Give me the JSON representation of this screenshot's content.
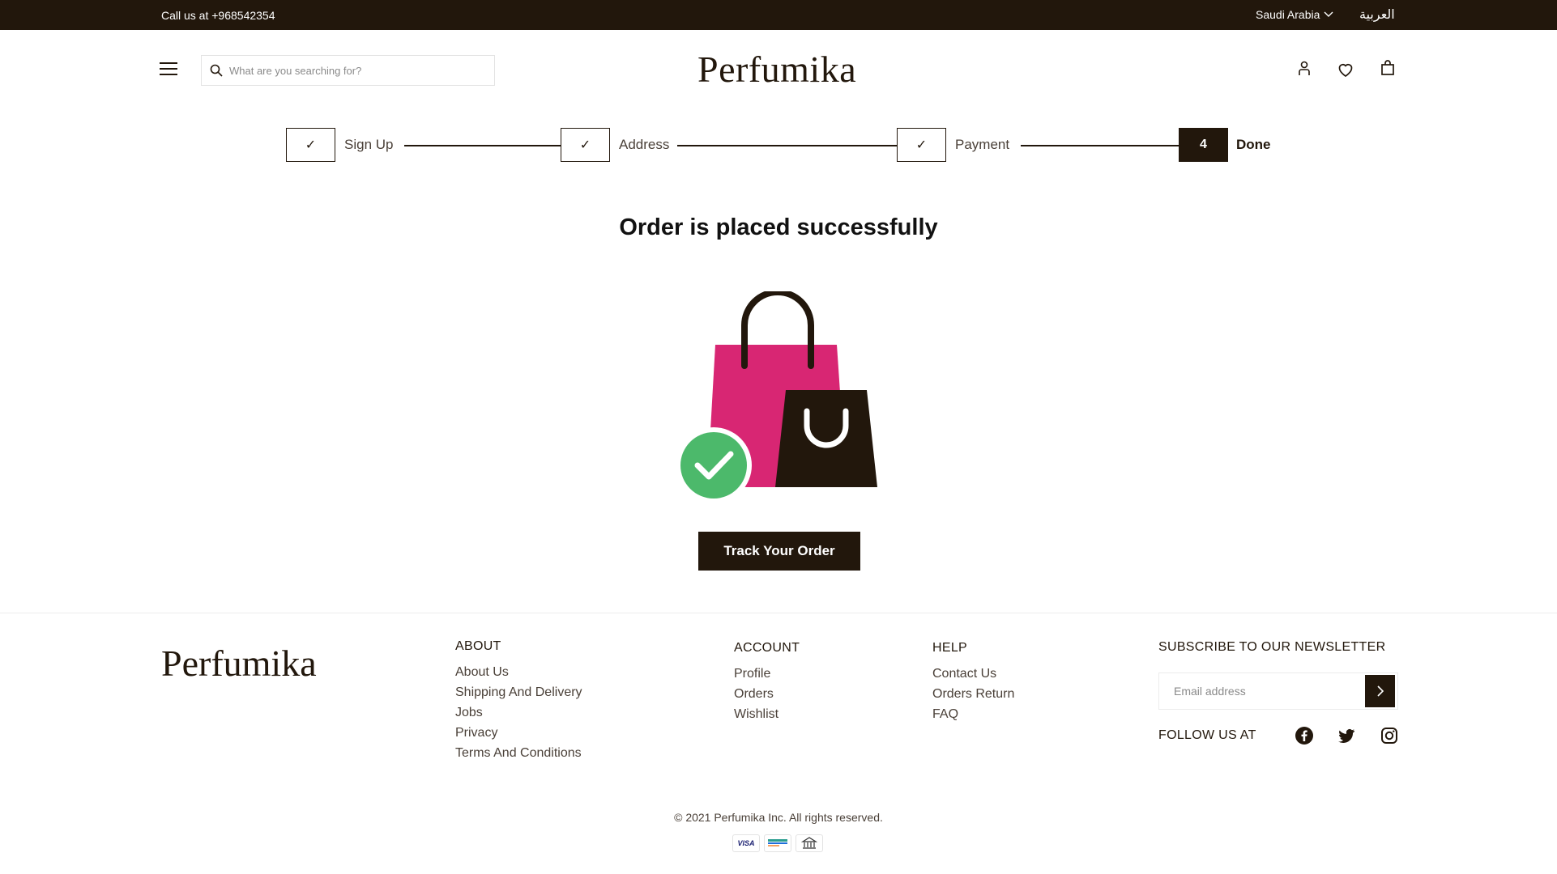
{
  "topbar": {
    "phone": "Call us at +968542354",
    "region": "Saudi Arabia",
    "language": "العربية"
  },
  "header": {
    "logo": "Perfumika",
    "search_placeholder": "What are you searching for?",
    "icons": [
      "menu-icon",
      "search-icon",
      "user-icon",
      "heart-icon",
      "shopping-bag-icon"
    ]
  },
  "stepper": {
    "steps": [
      {
        "label": "Sign Up",
        "marker": "✓",
        "status": "done"
      },
      {
        "label": "Address",
        "marker": "✓",
        "status": "done"
      },
      {
        "label": "Payment",
        "marker": "✓",
        "status": "done"
      },
      {
        "label": "Done",
        "marker": "4",
        "status": "active"
      }
    ]
  },
  "main": {
    "title": "Order is placed successfully",
    "track_button": "Track Your Order"
  },
  "footer": {
    "logo": "Perfumika",
    "about": {
      "heading": "ABOUT",
      "links": [
        "About Us",
        "Shipping And Delivery",
        "Jobs",
        "Privacy",
        "Terms And Conditions"
      ]
    },
    "account": {
      "heading": "ACCOUNT",
      "links": [
        "Profile",
        "Orders",
        "Wishlist"
      ]
    },
    "help": {
      "heading": "HELP",
      "links": [
        "Contact Us",
        "Orders Return",
        "FAQ"
      ]
    },
    "newsletter": {
      "heading": "SUBSCRIBE TO OUR NEWSLETTER",
      "email_placeholder": "Email address"
    },
    "follow_label": "FOLLOW US AT",
    "social": [
      "facebook-icon",
      "twitter-icon",
      "instagram-icon"
    ],
    "copyright": "© 2021 Perfumika Inc. All rights reserved.",
    "payments": [
      {
        "name": "visa-card-icon",
        "label": "VISA"
      },
      {
        "name": "card-icon",
        "label": ""
      },
      {
        "name": "bank-icon",
        "label": ""
      }
    ]
  },
  "colors": {
    "primary": "#22170c",
    "bag_pink": "#d82673",
    "success_green": "#4cb96b"
  }
}
